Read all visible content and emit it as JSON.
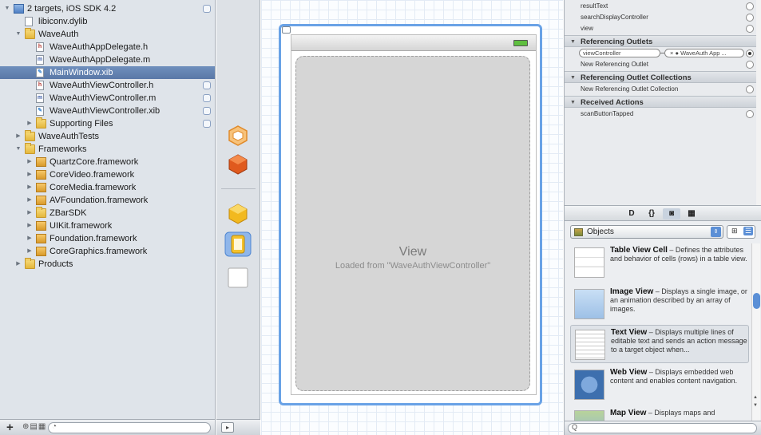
{
  "navigator": {
    "items": [
      {
        "label": "2 targets, iOS SDK 4.2",
        "indent": 0,
        "icon": "project",
        "disclosure": "open",
        "badge": true
      },
      {
        "label": "libiconv.dylib",
        "indent": 1,
        "icon": "lib",
        "disclosure": "",
        "badge": false
      },
      {
        "label": "WaveAuth",
        "indent": 1,
        "icon": "folder",
        "disclosure": "open",
        "badge": false
      },
      {
        "label": "WaveAuthAppDelegate.h",
        "indent": 2,
        "icon": "h",
        "disclosure": "",
        "badge": false
      },
      {
        "label": "WaveAuthAppDelegate.m",
        "indent": 2,
        "icon": "m",
        "disclosure": "",
        "badge": false
      },
      {
        "label": "MainWindow.xib",
        "indent": 2,
        "icon": "xib",
        "disclosure": "",
        "badge": false,
        "selected": true
      },
      {
        "label": "WaveAuthViewController.h",
        "indent": 2,
        "icon": "h",
        "disclosure": "",
        "badge": true
      },
      {
        "label": "WaveAuthViewController.m",
        "indent": 2,
        "icon": "m",
        "disclosure": "",
        "badge": true
      },
      {
        "label": "WaveAuthViewController.xib",
        "indent": 2,
        "icon": "xib",
        "disclosure": "",
        "badge": true
      },
      {
        "label": "Supporting Files",
        "indent": 2,
        "icon": "folder",
        "disclosure": "closed",
        "badge": true
      },
      {
        "label": "WaveAuthTests",
        "indent": 1,
        "icon": "folder",
        "disclosure": "closed",
        "badge": false
      },
      {
        "label": "Frameworks",
        "indent": 1,
        "icon": "folder",
        "disclosure": "open",
        "badge": false
      },
      {
        "label": "QuartzCore.framework",
        "indent": 2,
        "icon": "framework",
        "disclosure": "closed",
        "badge": false
      },
      {
        "label": "CoreVideo.framework",
        "indent": 2,
        "icon": "framework",
        "disclosure": "closed",
        "badge": false
      },
      {
        "label": "CoreMedia.framework",
        "indent": 2,
        "icon": "framework",
        "disclosure": "closed",
        "badge": false
      },
      {
        "label": "AVFoundation.framework",
        "indent": 2,
        "icon": "framework",
        "disclosure": "closed",
        "badge": false
      },
      {
        "label": "ZBarSDK",
        "indent": 2,
        "icon": "folder",
        "disclosure": "closed",
        "badge": false
      },
      {
        "label": "UIKit.framework",
        "indent": 2,
        "icon": "framework",
        "disclosure": "closed",
        "badge": false
      },
      {
        "label": "Foundation.framework",
        "indent": 2,
        "icon": "framework",
        "disclosure": "closed",
        "badge": false
      },
      {
        "label": "CoreGraphics.framework",
        "indent": 2,
        "icon": "framework",
        "disclosure": "closed",
        "badge": false
      },
      {
        "label": "Products",
        "indent": 1,
        "icon": "folder",
        "disclosure": "closed",
        "badge": false
      }
    ],
    "bottom": {
      "add": "+",
      "filters": "⊕▤▦"
    }
  },
  "canvas": {
    "view_title": "View",
    "view_subtitle": "Loaded from \"WaveAuthViewController\""
  },
  "inspector": {
    "outlets": [
      "resultText",
      "searchDisplayController",
      "view"
    ],
    "sections": {
      "referencing_outlets": "Referencing Outlets",
      "referencing_collections": "Referencing Outlet Collections",
      "received_actions": "Received Actions"
    },
    "referencing": {
      "source": "viewController",
      "target": "WaveAuth App ..."
    },
    "new_referencing_outlet": "New Referencing Outlet",
    "new_referencing_collection": "New Referencing Outlet Collection",
    "action": "scanButtonTapped"
  },
  "library": {
    "tabs": [
      "D",
      "{}",
      "◙",
      "▦"
    ],
    "popup_label": "Objects",
    "items": [
      {
        "title": "Table View Cell",
        "desc": " – Defines the attributes and behavior of cells (rows) in a table view."
      },
      {
        "title": "Image View",
        "desc": " – Displays a single image, or an animation described by an array of images."
      },
      {
        "title": "Text View",
        "desc": " – Displays multiple lines of editable text and sends an action message to a target object when..."
      },
      {
        "title": "Web View",
        "desc": " – Displays embedded web content and enables content navigation."
      },
      {
        "title": "Map View",
        "desc": " – Displays maps and"
      }
    ],
    "search_icon": "Q"
  },
  "colors": {
    "selection": "#69a2e6",
    "nav_selected": "#5a78a7"
  }
}
